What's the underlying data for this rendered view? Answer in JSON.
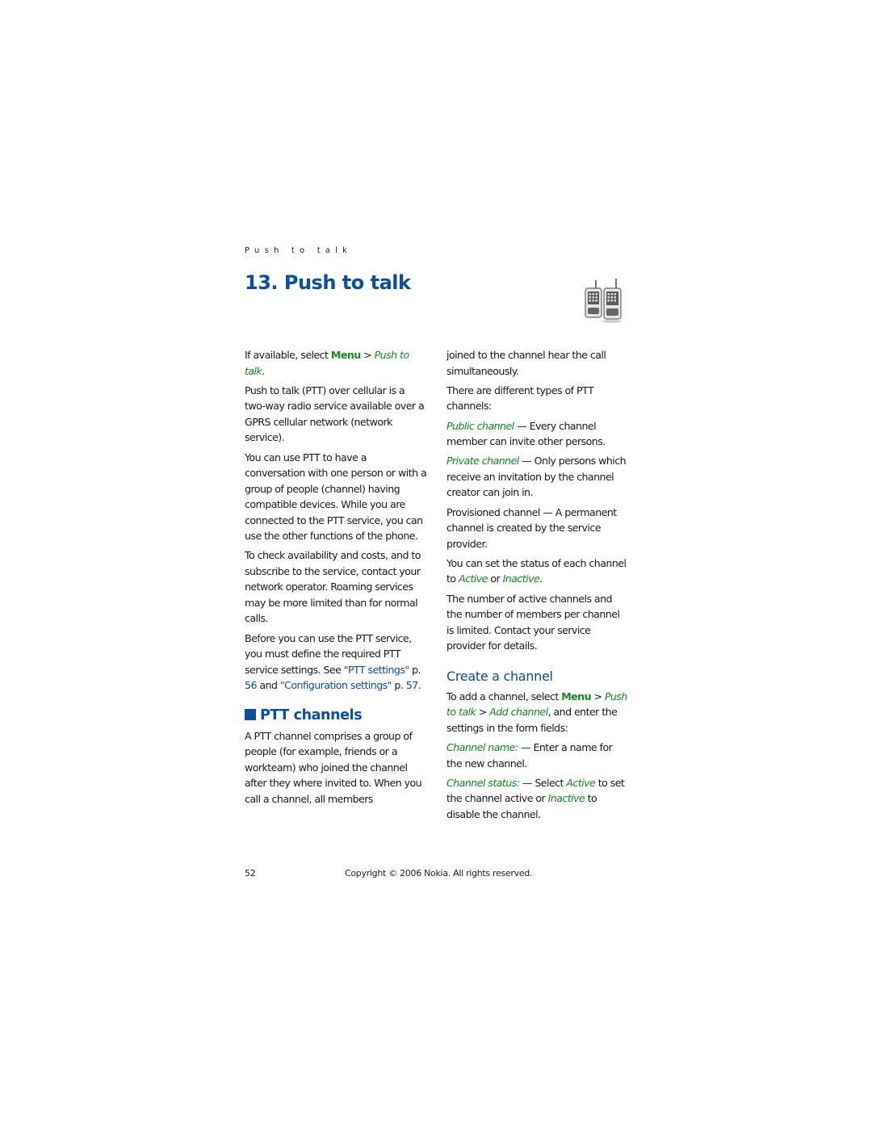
{
  "running_head": "Push to talk",
  "chapter": {
    "title": "13. Push to talk",
    "icon": "walkie-talkie-icon"
  },
  "left_column": {
    "intro": {
      "prefix": "If available, select ",
      "menu": "Menu",
      "sep": " > ",
      "path": "Push to talk",
      "suffix": "."
    },
    "p1": "Push to talk (PTT) over cellular is a two-way radio service available over a GPRS cellular network (network service).",
    "p2": "You can use PTT to have a conversation with one person or with a group of people (channel) having compatible devices. While you are connected to the PTT service, you can use the other functions of the phone.",
    "p3": "To check availability and costs, and to subscribe to the service, contact your network operator. Roaming services may be more limited than for normal calls.",
    "p4": {
      "text1": "Before you can use the PTT service, you must define the required PTT service settings. See ",
      "link1": "\"PTT settings\"",
      "text2": " p. ",
      "page1": "56",
      "text3": " and ",
      "link2": "\"Configuration settings\"",
      "text4": " p. ",
      "page2": "57",
      "text5": "."
    },
    "section_heading": "PTT channels",
    "p5": "A PTT channel comprises a group of people (for example, friends or a workteam) who joined the channel after they where invited to. When you call a channel, all members"
  },
  "right_column": {
    "p1": "joined to the channel hear the call simultaneously.",
    "p2": "There are different types of PTT channels:",
    "public": {
      "term": "Public channel",
      "desc": " — Every channel member can invite other persons."
    },
    "private": {
      "term": "Private channel",
      "desc": " — Only persons which receive an invitation by the channel creator can join in."
    },
    "provisioned": "Provisioned channel — A permanent channel is created by the service provider.",
    "status": {
      "text1": "You can set the status of each channel to ",
      "active": "Active",
      "or": " or ",
      "inactive": "Inactive",
      "end": "."
    },
    "limit": "The number of active channels and the number of members per channel is limited. Contact your service provider for details.",
    "subsection_heading": "Create a channel",
    "add": {
      "text1": "To add a channel, select ",
      "menu": "Menu",
      "sep1": " > ",
      "path1": "Push to talk",
      "sep2": " > ",
      "path2": "Add channel",
      "text2": ", and enter the settings in the form fields:"
    },
    "name_field": {
      "term": "Channel name:",
      "desc": " — Enter a name for the new channel."
    },
    "status_field": {
      "term": "Channel status:",
      "text1": " — Select ",
      "active": "Active",
      "text2": " to set the channel active or ",
      "inactive": "Inactive",
      "text3": " to disable the channel."
    }
  },
  "footer": {
    "page_number": "52",
    "copyright": "Copyright © 2006 Nokia. All rights reserved."
  },
  "colors": {
    "heading_blue": "#0b4ea2",
    "menu_green": "#138a1f"
  }
}
